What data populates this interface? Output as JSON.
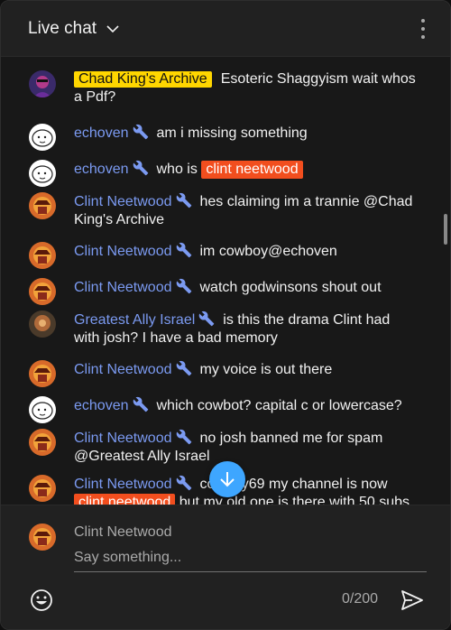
{
  "header": {
    "title": "Live chat"
  },
  "messages": [
    {
      "author": "Chad King's Archive",
      "role": "owner",
      "text": "Esoteric Shaggyism wait whos a Pdf?"
    },
    {
      "author": "echoven",
      "role": "moderator",
      "text": "am i missing something"
    },
    {
      "author": "echoven",
      "role": "moderator",
      "text_before": "who is",
      "mention": "clint neetwood"
    },
    {
      "author": "Clint Neetwood",
      "role": "moderator",
      "text": "hes claiming im a trannie @Chad King's Archive"
    },
    {
      "author": "Clint Neetwood",
      "role": "moderator",
      "text": "im cowboy@echoven"
    },
    {
      "author": "Clint Neetwood",
      "role": "moderator",
      "text": "watch godwinsons shout out"
    },
    {
      "author": "Greatest Ally Israel",
      "role": "moderator",
      "text": "is this the drama Clint had with josh? I have a bad memory"
    },
    {
      "author": "Clint Neetwood",
      "role": "moderator",
      "text": "my voice is out there"
    },
    {
      "author": "echoven",
      "role": "moderator",
      "text": "which cowbot? capital c or lowercase?"
    },
    {
      "author": "Clint Neetwood",
      "role": "moderator",
      "text": "no josh banned me for spam @Greatest Ally Israel"
    },
    {
      "author": "Clint Neetwood",
      "role": "moderator",
      "text_before": "cowboy69 my channel is now",
      "mention": "clint neetwood",
      "text_after": "but my old one is there with 50 subs"
    }
  ],
  "composer": {
    "username": "Clint Neetwood",
    "placeholder": "Say something...",
    "counter": "0/200"
  },
  "colors": {
    "author_link": "#7b9af1",
    "owner_badge": "#ffd600",
    "mention_bg": "#f24e1e",
    "accent": "#3ea6ff"
  },
  "icons": [
    "chevron-down-icon",
    "more-vert-icon",
    "wrench-icon",
    "arrow-down-icon",
    "emoji-icon",
    "send-icon"
  ]
}
